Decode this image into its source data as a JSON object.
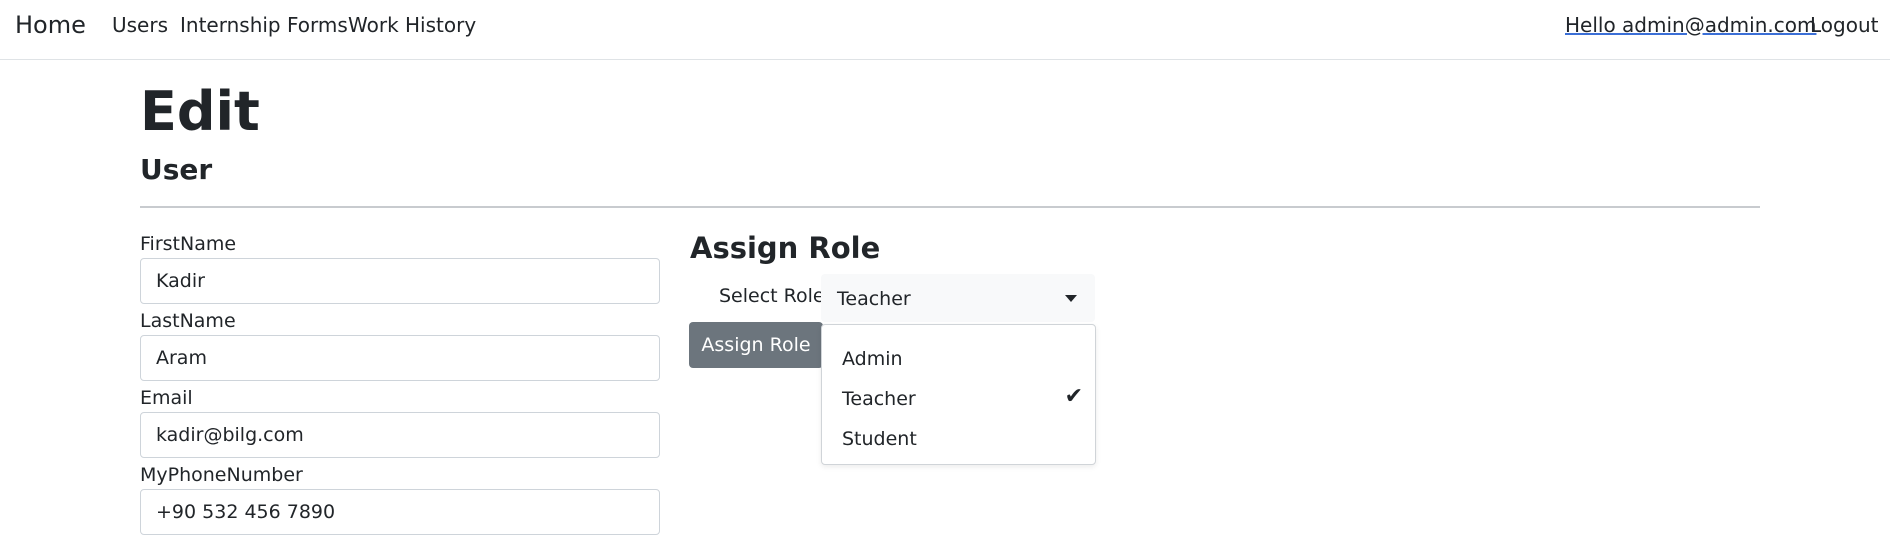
{
  "nav": {
    "brand": "Home",
    "links": [
      "Users",
      "Internship Forms",
      "Work History"
    ],
    "user_greeting": "Hello admin@admin.com",
    "logout": "Logout"
  },
  "page": {
    "title": "Edit",
    "subtitle": "User"
  },
  "form": {
    "fields": [
      {
        "label": "FirstName",
        "value": "Kadir"
      },
      {
        "label": "LastName",
        "value": "Aram"
      },
      {
        "label": "Email",
        "value": "kadir@bilg.com"
      },
      {
        "label": "MyPhoneNumber",
        "value": "+90 532 456 7890"
      }
    ]
  },
  "assign_role": {
    "heading": "Assign Role",
    "select_label": "Select Role",
    "selected": "Teacher",
    "button": "Assign Role",
    "options": [
      "Admin",
      "Teacher",
      "Student"
    ],
    "checked_index": 1,
    "check_icon": "check-icon"
  },
  "colors": {
    "button_bg": "#6c757d",
    "link_underline": "#3b6fd6",
    "text": "#212529"
  }
}
